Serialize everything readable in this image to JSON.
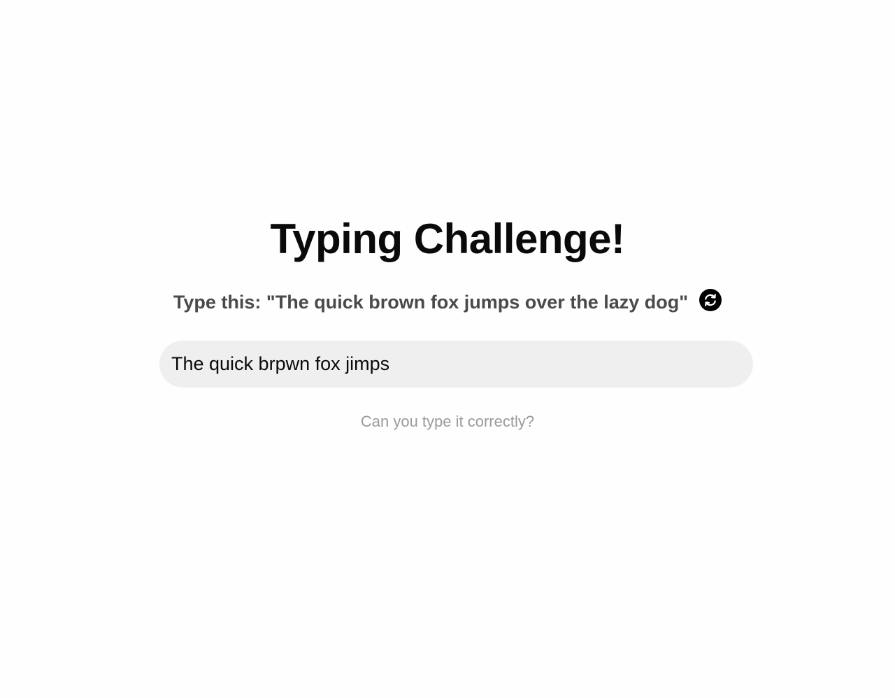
{
  "title": "Typing Challenge!",
  "prompt": {
    "text": "Type this: \"The quick brown fox jumps over the lazy dog\"",
    "refresh_icon": "refresh-icon"
  },
  "input": {
    "value": "The quick brpwn fox jimps"
  },
  "hint": "Can you type it correctly?",
  "colors": {
    "background": "#fefefe",
    "title": "#0a0a0a",
    "prompt": "#4a4a4a",
    "input_bg": "#efefef",
    "hint": "#9a9a9a",
    "refresh_button": "#000000"
  }
}
